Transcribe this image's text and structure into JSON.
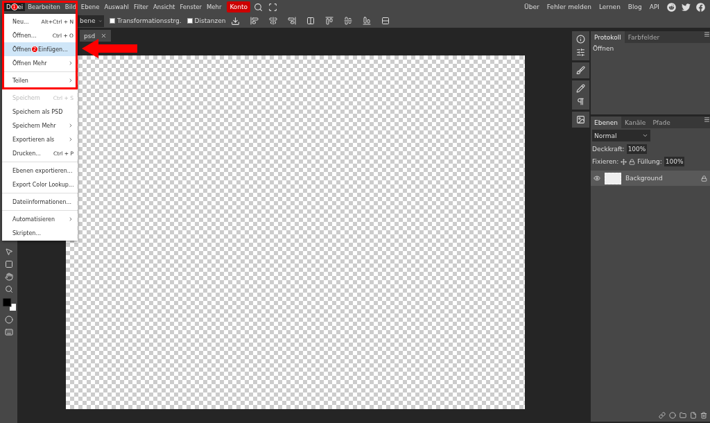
{
  "menubar": {
    "items": [
      {
        "label": "D",
        "label_after": "ei",
        "selected": true,
        "kind": "menu",
        "badge": "1"
      },
      {
        "label": "Bearbeiten",
        "selected": false,
        "kind": "menu"
      },
      {
        "label": "Bild",
        "selected": false,
        "kind": "menu"
      },
      {
        "label": "Ebene",
        "selected": false,
        "kind": "menu"
      },
      {
        "label": "Auswahl",
        "selected": false,
        "kind": "menu"
      },
      {
        "label": "Filter",
        "selected": false,
        "kind": "menu"
      },
      {
        "label": "Ansicht",
        "selected": false,
        "kind": "menu"
      },
      {
        "label": "Fenster",
        "selected": false,
        "kind": "menu"
      },
      {
        "label": "Mehr",
        "selected": false,
        "kind": "menu"
      },
      {
        "label": "Konto",
        "kind": "account"
      }
    ],
    "links": [
      "Über",
      "Fehler melden",
      "Lernen",
      "Blog",
      "API"
    ]
  },
  "file_menu": {
    "groups": [
      [
        {
          "label": "Neu...",
          "shortcut": "Alt+Ctrl + N",
          "submenu": false,
          "disabled": false,
          "selected": false
        },
        {
          "label": "Öffnen...",
          "shortcut": "Ctrl + O",
          "submenu": false,
          "disabled": false,
          "selected": false
        },
        {
          "label": "Öffnen",
          "label_after": "Einfügen...",
          "badge": "2",
          "submenu": false,
          "disabled": false,
          "selected": true
        },
        {
          "label": "Öffnen Mehr",
          "submenu": true,
          "disabled": false,
          "selected": false
        }
      ],
      [
        {
          "label": "Teilen",
          "submenu": true,
          "disabled": false,
          "selected": false
        }
      ],
      [
        {
          "label": "Speichern",
          "shortcut": "Ctrl + S",
          "submenu": false,
          "disabled": true,
          "selected": false
        },
        {
          "label": "Speichern als PSD",
          "submenu": false,
          "disabled": false,
          "selected": false
        },
        {
          "label": "Speichern Mehr",
          "submenu": true,
          "disabled": false,
          "selected": false
        },
        {
          "label": "Exportieren als",
          "submenu": true,
          "disabled": false,
          "selected": false
        },
        {
          "label": "Drucken...",
          "shortcut": "Ctrl + P",
          "submenu": false,
          "disabled": false,
          "selected": false
        }
      ],
      [
        {
          "label": "Ebenen exportieren...",
          "submenu": false,
          "disabled": false,
          "selected": false
        },
        {
          "label": "Export Color Lookup...",
          "submenu": false,
          "disabled": false,
          "selected": false
        }
      ],
      [
        {
          "label": "Dateiinformationen...",
          "submenu": false,
          "disabled": false,
          "selected": false
        }
      ],
      [
        {
          "label": "Automatisieren",
          "submenu": true,
          "disabled": false,
          "selected": false
        },
        {
          "label": "Skripten...",
          "submenu": false,
          "disabled": false,
          "selected": false
        }
      ]
    ]
  },
  "toolbar": {
    "select": "bene",
    "checkboxes": [
      {
        "label": "Transformationsstrg.",
        "checked": false
      },
      {
        "label": "Distanzen",
        "checked": false
      }
    ]
  },
  "document_tab": {
    "title": "psd"
  },
  "history_panel": {
    "tabs": [
      {
        "label": "Protokoll",
        "selected": true
      },
      {
        "label": "Farbfelder",
        "selected": false
      }
    ],
    "entries": [
      "Öffnen"
    ]
  },
  "layers_panel": {
    "tabs": [
      {
        "label": "Ebenen",
        "selected": true
      },
      {
        "label": "Kanäle",
        "selected": false
      },
      {
        "label": "Pfade",
        "selected": false
      }
    ],
    "blend_mode": "Normal",
    "opacity_label": "Deckkraft:",
    "opacity": "100%",
    "lock_label": "Fixieren:",
    "fill_label": "Füllung:",
    "fill": "100%",
    "layers": [
      {
        "name": "Background",
        "visible": true,
        "locked": true,
        "selected": true
      }
    ]
  }
}
